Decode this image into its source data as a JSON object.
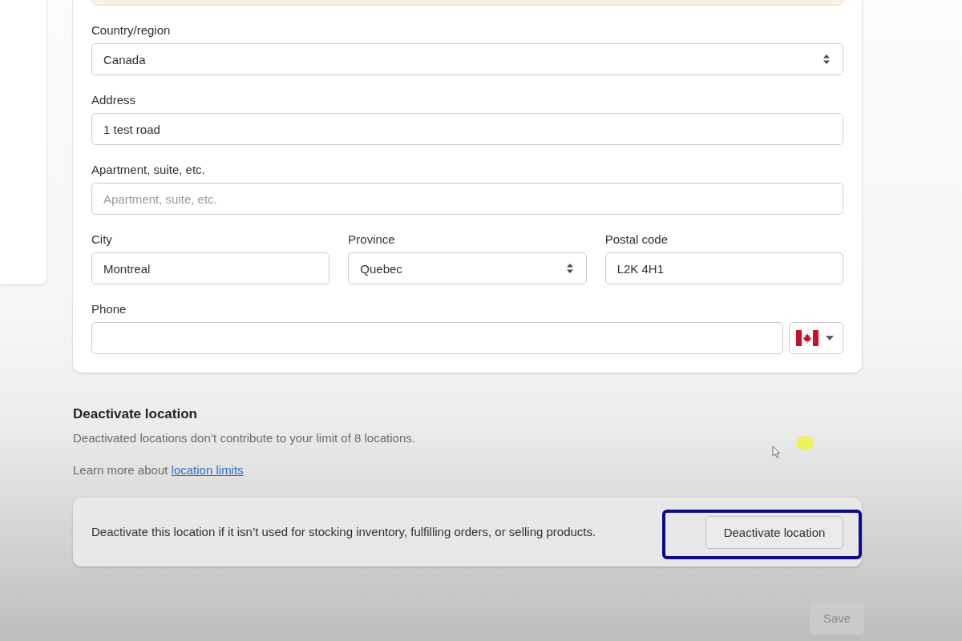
{
  "form": {
    "rows": [
      {
        "fields": [
          {
            "kind": "select",
            "label": "Country/region",
            "value": "Canada"
          }
        ]
      },
      {
        "fields": [
          {
            "kind": "text",
            "label": "Address",
            "value": "1 test road"
          }
        ]
      },
      {
        "fields": [
          {
            "kind": "text",
            "label": "Apartment, suite, etc.",
            "placeholder": "Apartment, suite, etc."
          }
        ]
      },
      {
        "fields": [
          {
            "kind": "text",
            "label": "City",
            "value": "Montreal"
          },
          {
            "kind": "select",
            "label": "Province",
            "value": "Quebec"
          },
          {
            "kind": "text",
            "label": "Postal code",
            "value": "L2K 4H1"
          }
        ]
      },
      {
        "fields": [
          {
            "kind": "phone",
            "label": "Phone"
          }
        ]
      }
    ]
  },
  "deactivate_section": {
    "title": "Deactivate location",
    "description": "Deactivated locations don’t contribute to your limit of 8 locations.",
    "learn_more": {
      "text": "Learn more about",
      "link": "location limits"
    },
    "panel": {
      "text": "Deactivate this location if it isn’t used for stocking inventory, fulfilling orders, or selling products.",
      "button": "Deactivate location",
      "highlighted": true
    }
  },
  "save_button": {
    "label": "Save",
    "disabled": true
  }
}
